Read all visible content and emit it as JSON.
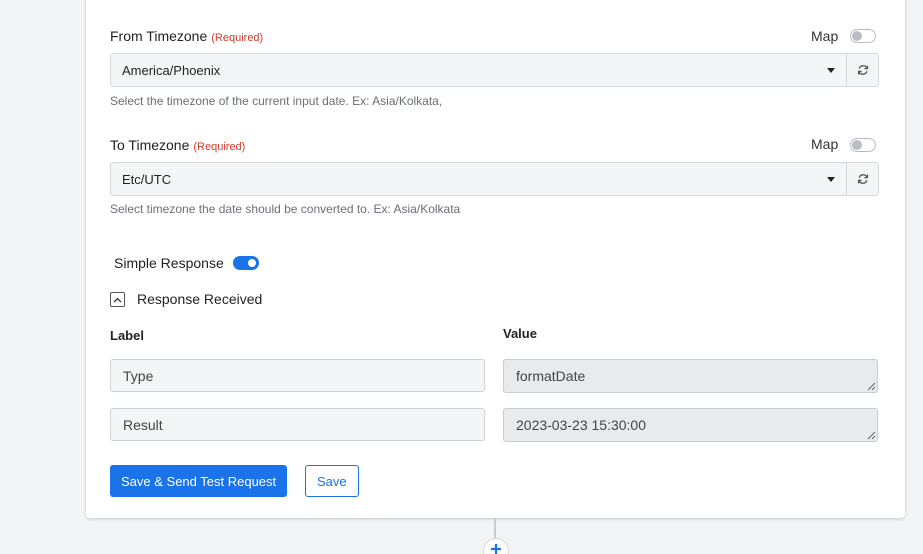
{
  "from_timezone": {
    "label": "From Timezone",
    "required": "(Required)",
    "map_label": "Map",
    "selected": "America/Phoenix",
    "help": "Select the timezone of the current input date. Ex: Asia/Kolkata,"
  },
  "to_timezone": {
    "label": "To Timezone",
    "required": "(Required)",
    "map_label": "Map",
    "selected": "Etc/UTC",
    "help": "Select timezone the date should be converted to. Ex: Asia/Kolkata"
  },
  "simple_response": {
    "label": "Simple Response",
    "enabled": true
  },
  "response_received": {
    "label": "Response Received",
    "columns": {
      "label": "Label",
      "value": "Value"
    },
    "rows": [
      {
        "label": "Type",
        "value": "formatDate"
      },
      {
        "label": "Result",
        "value": "2023-03-23 15:30:00"
      }
    ]
  },
  "actions": {
    "save_send": "Save & Send Test Request",
    "save": "Save"
  },
  "colors": {
    "accent": "#1a73e8",
    "required": "#d33a2c"
  },
  "icons": [
    "refresh-icon",
    "caret-down-icon",
    "chevron-up-icon",
    "plus-icon"
  ]
}
